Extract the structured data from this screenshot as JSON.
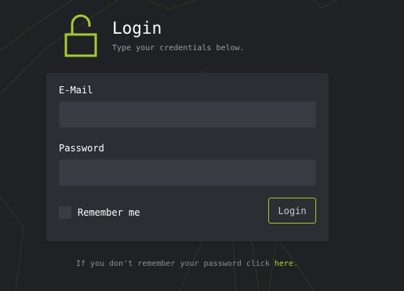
{
  "header": {
    "title": "Login",
    "subtitle": "Type your credentials below."
  },
  "form": {
    "email_label": "E-Mail",
    "email_value": "",
    "password_label": "Password",
    "password_value": "",
    "remember_label": "Remember me",
    "remember_checked": false,
    "login_label": "Login"
  },
  "footer": {
    "text": "If you don't remember your password click ",
    "link": "here",
    "suffix": "."
  },
  "icons": {
    "lock": "unlocked-padlock-icon"
  },
  "colors": {
    "accent": "#a6c930",
    "background": "#1f2124",
    "card": "#2b2e33",
    "input": "#393d43",
    "link": "#b5d334"
  }
}
